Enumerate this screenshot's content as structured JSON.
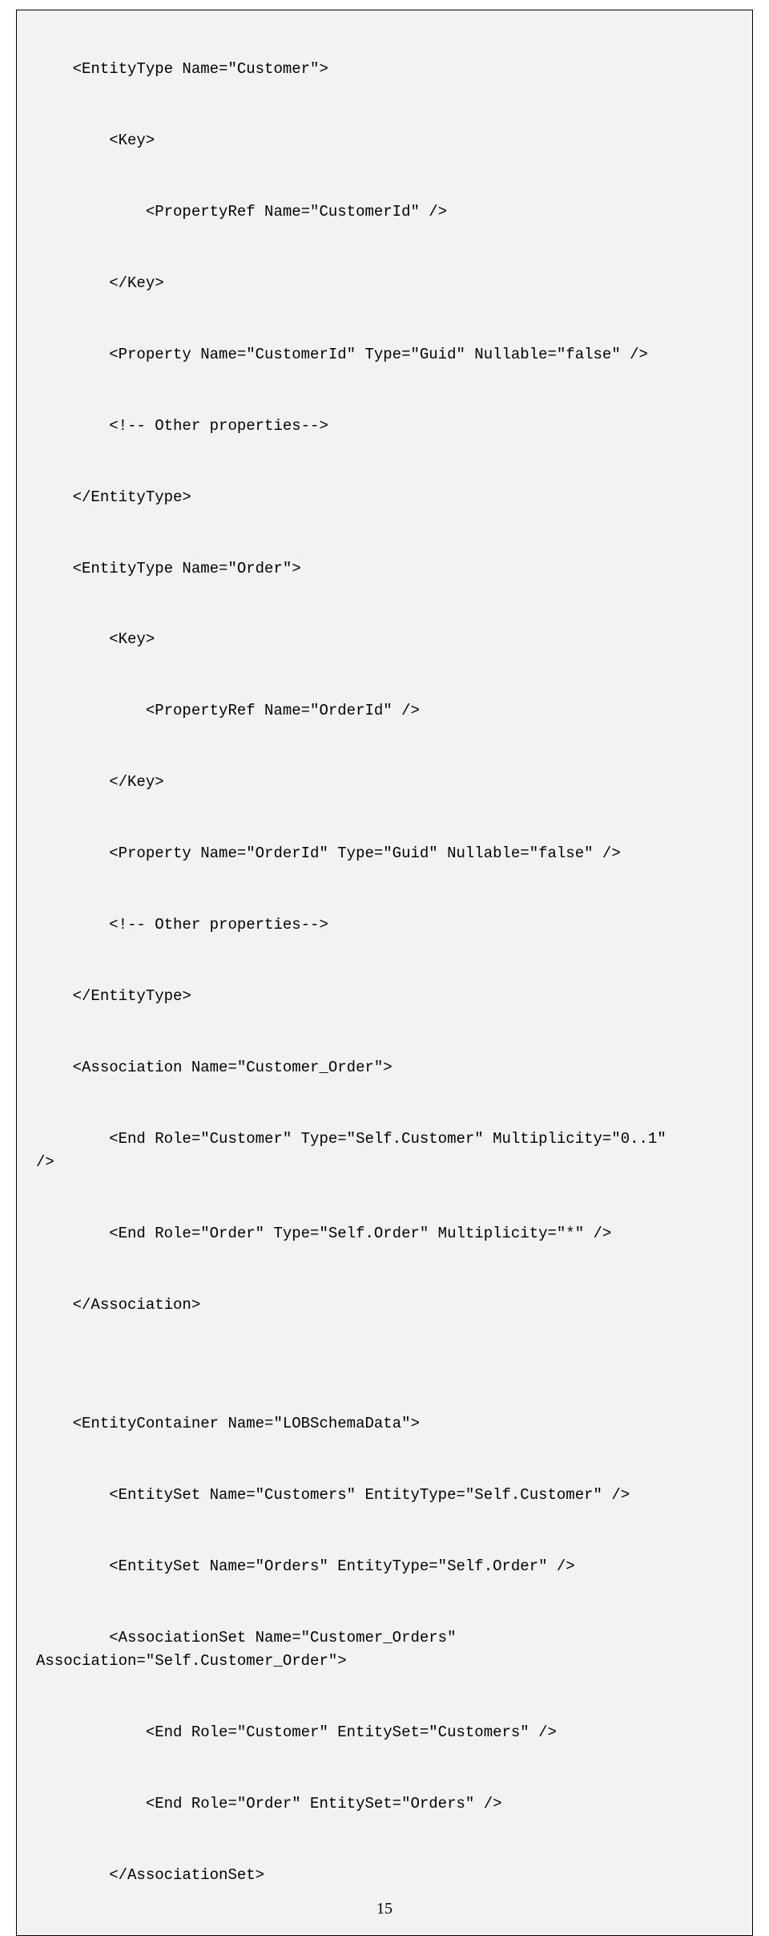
{
  "code": {
    "l01": "    <EntityType Name=\"Customer\">",
    "l02": "        <Key>",
    "l03": "            <PropertyRef Name=\"CustomerId\" />",
    "l04": "        </Key>",
    "l05": "        <Property Name=\"CustomerId\" Type=\"Guid\" Nullable=\"false\" />",
    "l06": "        <!-- Other properties-->",
    "l07": "    </EntityType>",
    "l08": "    <EntityType Name=\"Order\">",
    "l09": "        <Key>",
    "l10": "            <PropertyRef Name=\"OrderId\" />",
    "l11": "        </Key>",
    "l12": "        <Property Name=\"OrderId\" Type=\"Guid\" Nullable=\"false\" />",
    "l13": "        <!-- Other properties-->",
    "l14": "    </EntityType>",
    "l15": "    <Association Name=\"Customer_Order\">",
    "l16": "        <End Role=\"Customer\" Type=\"Self.Customer\" Multiplicity=\"0..1\"",
    "l17": "/>",
    "l18": "        <End Role=\"Order\" Type=\"Self.Order\" Multiplicity=\"*\" />",
    "l19": "    </Association>",
    "l20": "    <EntityContainer Name=\"LOBSchemaData\">",
    "l21": "        <EntitySet Name=\"Customers\" EntityType=\"Self.Customer\" />",
    "l22": "        <EntitySet Name=\"Orders\" EntityType=\"Self.Order\" />",
    "l23": "        <AssociationSet Name=\"Customer_Orders\"",
    "l24": "Association=\"Self.Customer_Order\">",
    "l25": "            <End Role=\"Customer\" EntitySet=\"Customers\" />",
    "l26": "            <End Role=\"Order\" EntitySet=\"Orders\" />",
    "l27": "        </AssociationSet>"
  },
  "page_number": "15"
}
